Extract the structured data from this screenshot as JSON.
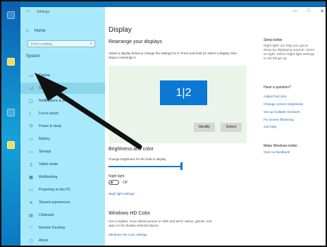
{
  "window": {
    "title": "Settings",
    "controls": [
      "—",
      "□",
      "✕"
    ]
  },
  "sidebar": {
    "home": "Home",
    "search_placeholder": "Find a setting",
    "section": "System",
    "items": [
      {
        "label": "Display",
        "icon": "monitor-icon"
      },
      {
        "label": "Sound",
        "icon": "speaker-icon"
      },
      {
        "label": "Notifications & actions",
        "icon": "notification-icon"
      },
      {
        "label": "Focus assist",
        "icon": "moon-icon"
      },
      {
        "label": "Power & sleep",
        "icon": "power-icon"
      },
      {
        "label": "Battery",
        "icon": "battery-icon"
      },
      {
        "label": "Storage",
        "icon": "storage-icon"
      },
      {
        "label": "Tablet mode",
        "icon": "tablet-icon"
      },
      {
        "label": "Multitasking",
        "icon": "multitask-icon"
      },
      {
        "label": "Projecting to this PC",
        "icon": "project-icon"
      },
      {
        "label": "Shared experiences",
        "icon": "share-icon"
      },
      {
        "label": "Clipboard",
        "icon": "clipboard-icon"
      },
      {
        "label": "Remote Desktop",
        "icon": "remote-icon"
      },
      {
        "label": "About",
        "icon": "info-icon"
      }
    ]
  },
  "content": {
    "title": "Display",
    "rearrange_title": "Rearrange your displays",
    "rearrange_desc": "Select a display below to change the settings for it. Press and hold (or select a display, then drag to rearrange it.",
    "monitor_label": "1|2",
    "identify": "Identify",
    "detect": "Detect",
    "brightness_title": "Brightness and color",
    "brightness_desc": "Change brightness for the built-in display",
    "night_light_title": "Night light",
    "night_light_state": "Off",
    "night_light_link": "Night light settings",
    "hd_title": "Windows HD Color",
    "hd_desc": "Get a brighter, more vibrant picture in HDR and WCG videos, games, and apps on the display selected above.",
    "hd_link": "Windows HD Color settings"
  },
  "right_column": {
    "sleep_title": "Sleep better",
    "sleep_desc": "Night light can help you get to sleep by displaying warmer colors at night. Select Night light settings to set things up.",
    "question_title": "Have a question?",
    "links": [
      "Adjust font size",
      "Change screen brightness",
      "Set up multiple monitors",
      "Fix screen flickering",
      "Get help"
    ],
    "better_title": "Make Windows better",
    "feedback": "Give us feedback"
  },
  "colors": {
    "sidebar_bg": "#a8eafb",
    "accent": "#0b78d4",
    "link": "#2c67ba",
    "annotation_arrow": "#111111"
  }
}
